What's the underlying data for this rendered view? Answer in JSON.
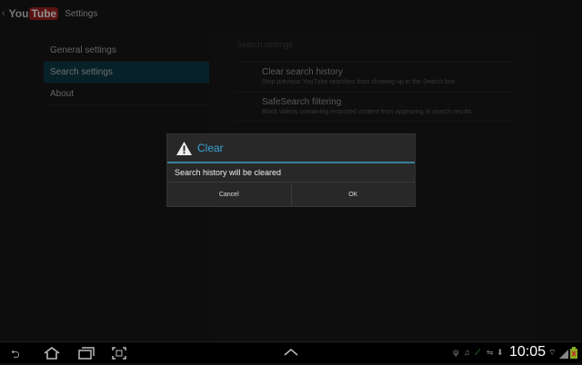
{
  "header": {
    "logo_you": "You",
    "logo_tube": "Tube",
    "title": "Settings"
  },
  "sidebar": {
    "items": [
      {
        "label": "General settings"
      },
      {
        "label": "Search settings",
        "active": true
      },
      {
        "label": "About"
      }
    ]
  },
  "panel": {
    "heading": "Search settings",
    "prefs": [
      {
        "title": "Clear search history",
        "summary": "Stop previous YouTube searches from showing up in the Search box"
      },
      {
        "title": "SafeSearch filtering",
        "summary": "Block videos containing restricted content from appearing in search results"
      }
    ]
  },
  "dialog": {
    "title": "Clear",
    "icon": "warning-icon",
    "message": "Search history will be cleared",
    "cancel": "Cancel",
    "ok": "OK",
    "accent": "#3ca7d8"
  },
  "statusbar": {
    "time": "10:05",
    "icons": [
      "usb-icon",
      "music-icon",
      "sync-icon",
      "data-icon",
      "download-icon",
      "wifi-icon",
      "signal-icon",
      "battery-icon"
    ]
  }
}
